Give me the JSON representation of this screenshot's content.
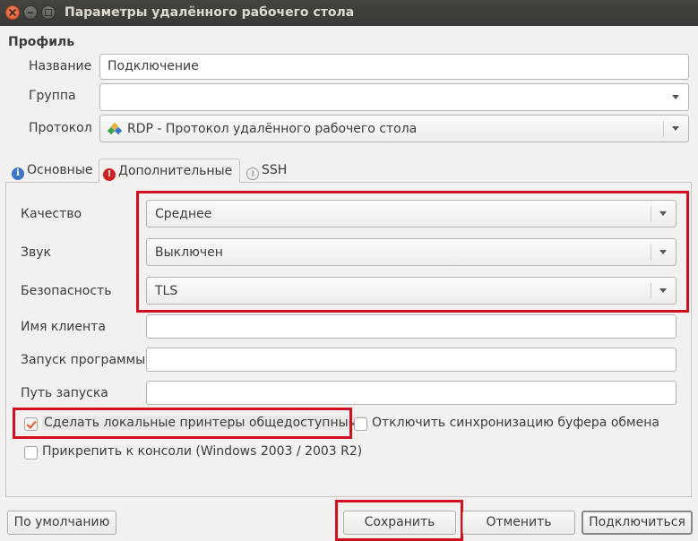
{
  "window": {
    "title": "Параметры удалённого рабочего стола"
  },
  "profile": {
    "section_label": "Профиль",
    "name_label": "Название",
    "name_value": "Подключение",
    "group_label": "Группа",
    "group_value": "",
    "protocol_label": "Протокол",
    "protocol_value": "RDP - Протокол удалённого рабочего стола",
    "protocol_icon": "rdp-protocol-icon"
  },
  "tabs": [
    {
      "label": "Основные",
      "icon": "info-icon",
      "active": false
    },
    {
      "label": "Дополнительные",
      "icon": "warning-icon",
      "active": true
    },
    {
      "label": "SSH",
      "icon": "key-icon",
      "active": false
    }
  ],
  "advanced": {
    "quality_label": "Качество",
    "quality_value": "Среднее",
    "sound_label": "Звук",
    "sound_value": "Выключен",
    "security_label": "Безопасность",
    "security_value": "TLS",
    "client_name_label": "Имя клиента",
    "client_name_value": "",
    "startup_program_label": "Запуск программы",
    "startup_program_value": "",
    "startup_path_label": "Путь запуска",
    "startup_path_value": "",
    "share_printers_label": "Сделать локальные принтеры общедоступными",
    "share_printers_checked": true,
    "disable_clipboard_label": "Отключить синхронизацию буфера обмена",
    "disable_clipboard_checked": false,
    "attach_console_label": "Прикрепить к консоли (Windows 2003 / 2003 R2)",
    "attach_console_checked": false
  },
  "buttons": {
    "default_label": "По умолчанию",
    "save_label": "Сохранить",
    "cancel_label": "Отменить",
    "connect_label": "Подключиться"
  },
  "colors": {
    "highlight_box": "#d0101e",
    "titlebar": "#3c3b37",
    "checkbox_accent": "#e05a28"
  }
}
